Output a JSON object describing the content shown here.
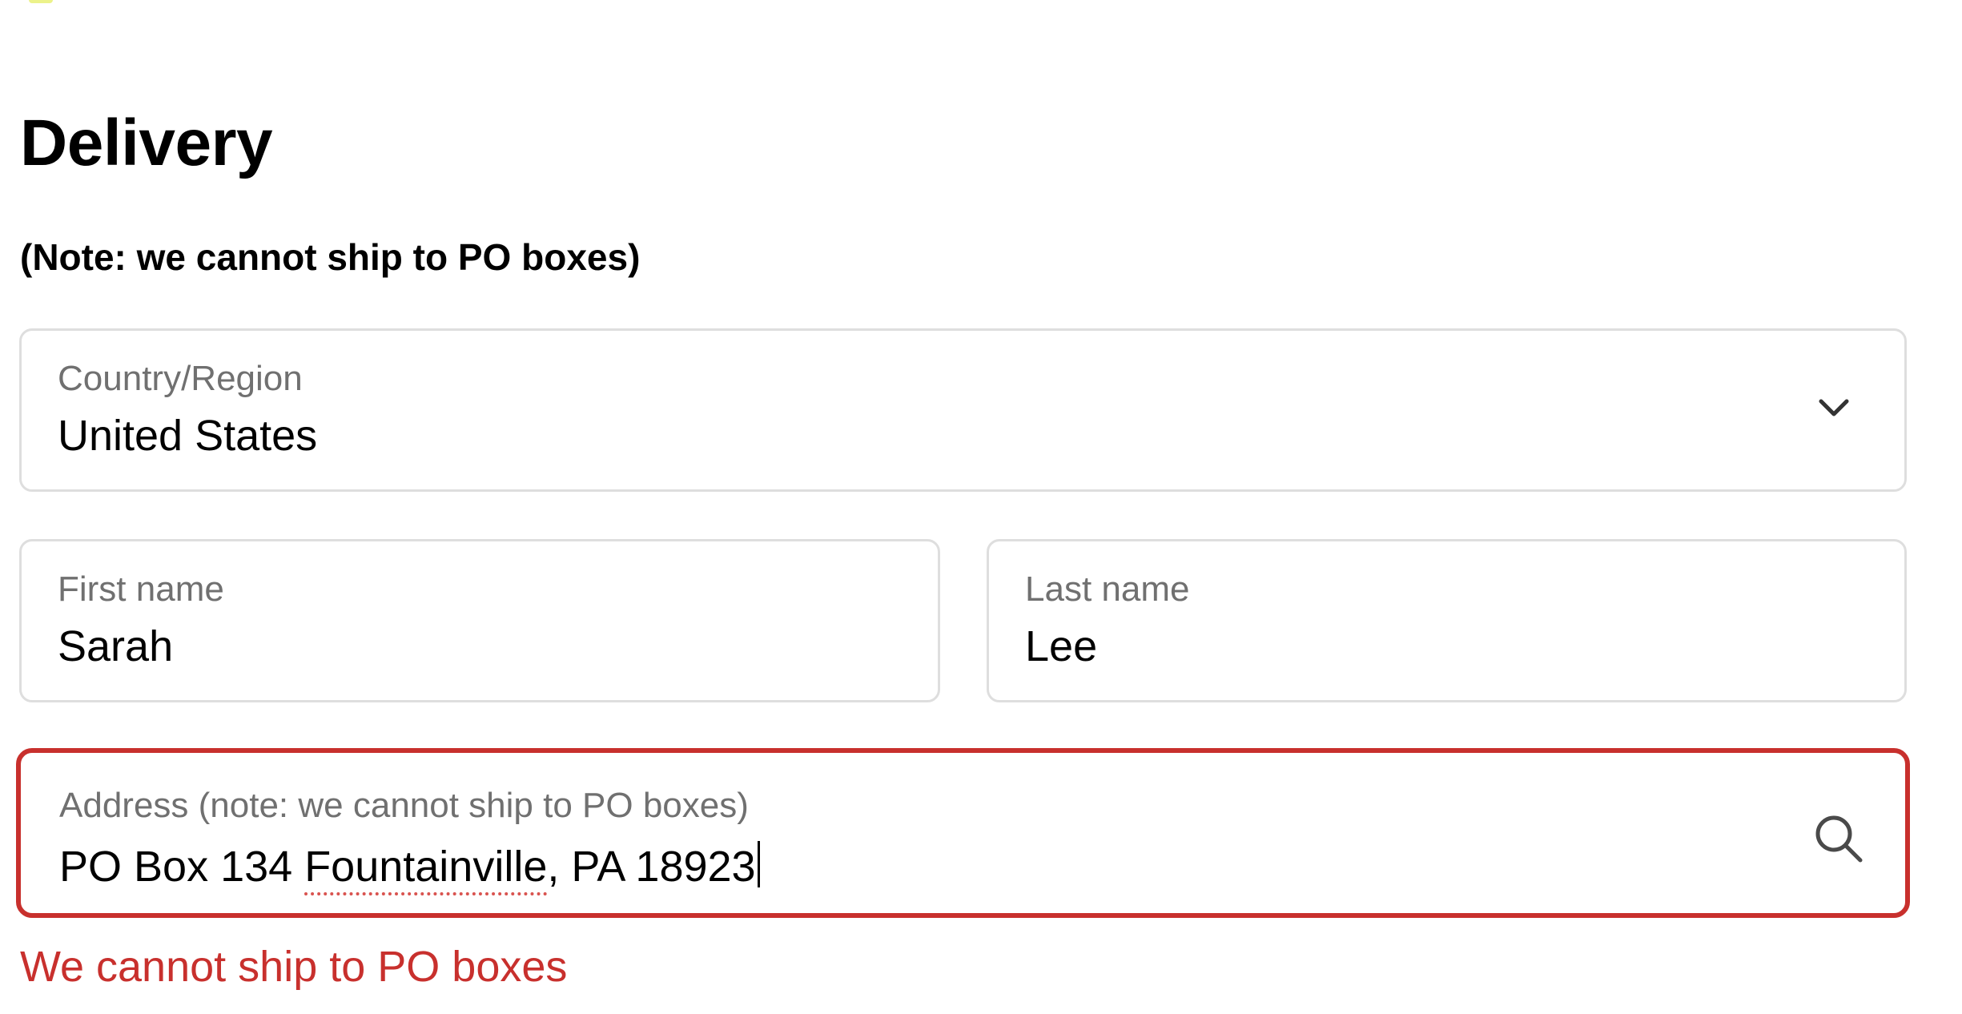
{
  "section": {
    "title": "Delivery",
    "note": "(Note: we cannot ship to PO boxes)"
  },
  "country_field": {
    "label": "Country/Region",
    "value": "United States",
    "icon": "chevron-down-icon"
  },
  "first_name_field": {
    "label": "First name",
    "value": "Sarah"
  },
  "last_name_field": {
    "label": "Last name",
    "value": "Lee"
  },
  "address_field": {
    "label": "Address (note: we cannot ship to PO boxes)",
    "value_prefix": "PO Box 134 ",
    "value_flagged_word": "Fountainville",
    "value_suffix": ", PA 18923",
    "icon": "search-icon",
    "error_color": "#c8302d"
  },
  "errors": {
    "address": "We cannot ship to PO boxes"
  }
}
